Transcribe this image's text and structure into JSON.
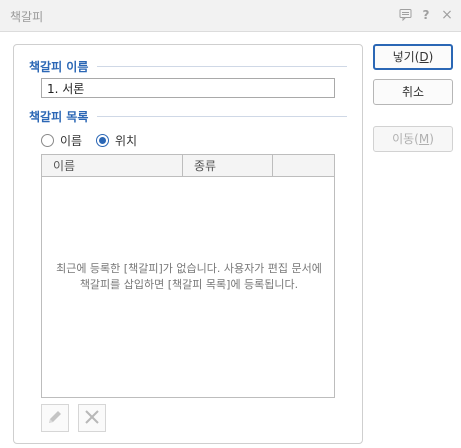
{
  "window": {
    "title": "책갈피"
  },
  "form": {
    "name_label": "책갈피 이름",
    "name_value": "1. 서론",
    "list_label": "책갈피 목록",
    "sort_options": [
      {
        "label": "이름",
        "selected": false
      },
      {
        "label": "위치",
        "selected": true
      }
    ],
    "columns": [
      "이름",
      "종류",
      ""
    ],
    "empty_message": "최근에 등록한 [책갈피]가 없습니다. 사용자가 편집 문서에 책갈피를 삽입하면 [책갈피 목록]에 등록됩니다."
  },
  "buttons": {
    "insert": {
      "label": "넣기",
      "key": "D"
    },
    "cancel": {
      "label": "취소"
    },
    "move": {
      "label": "이동",
      "key": "M"
    }
  },
  "colors": {
    "accent": "#2b67b5"
  },
  "icons": {
    "edit": "pencil-icon",
    "delete": "x-icon",
    "message": "message-icon",
    "help": "help-icon",
    "close": "close-icon"
  }
}
